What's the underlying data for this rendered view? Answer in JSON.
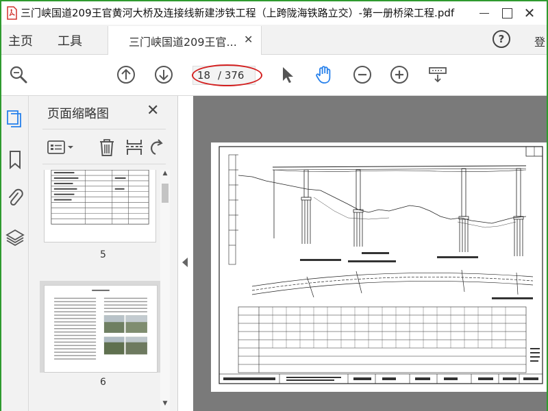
{
  "window": {
    "title": "三门峡国道209王官黄河大桥及连接线新建涉铁工程（上跨陇海铁路立交）-第一册桥梁工程.pdf",
    "close_glyph": "✕"
  },
  "menu": {
    "home": "主页",
    "tools": "工具",
    "help": "?",
    "login": "登"
  },
  "tab": {
    "label": "三门峡国道209王官...",
    "close_glyph": "✕"
  },
  "toolbar": {
    "page_current": "18",
    "page_total": "/ 376"
  },
  "thumbnails": {
    "title": "页面缩略图",
    "close_glyph": "✕",
    "pages": [
      {
        "label": "5"
      },
      {
        "label": "6"
      }
    ]
  },
  "colors": {
    "accent": "#2f9a2f",
    "icon_blue": "#2680eb",
    "highlight_red": "#d31f1f"
  },
  "icons": [
    "pdf-icon",
    "zoom-search-icon",
    "arrow-up-icon",
    "arrow-down-icon",
    "select-cursor-icon",
    "hand-icon",
    "zoom-out-icon",
    "zoom-in-icon",
    "display-mode-icon",
    "page-thumbnails-icon",
    "bookmark-icon",
    "attachment-icon",
    "layers-icon",
    "options-icon",
    "delete-icon",
    "extract-icon",
    "rotate-icon"
  ]
}
